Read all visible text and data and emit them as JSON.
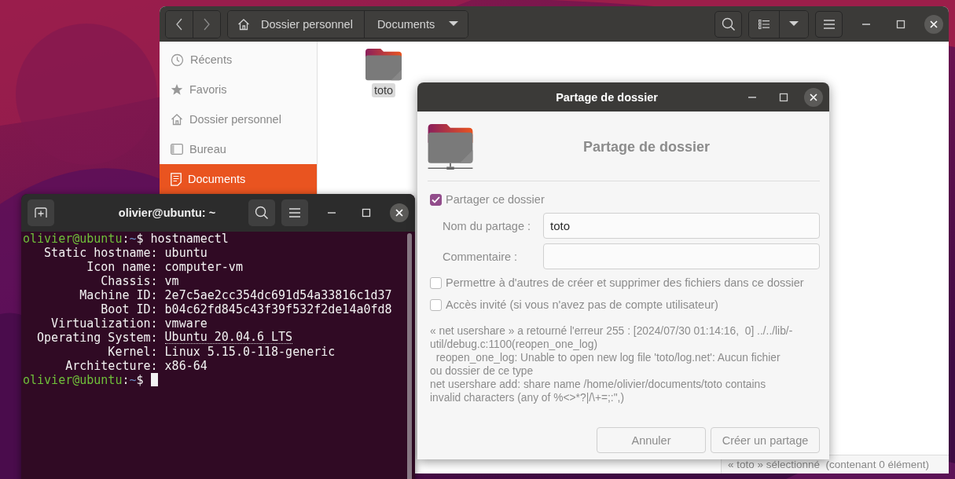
{
  "file_manager": {
    "path": [
      {
        "kind": "home",
        "label": "Dossier personnel"
      },
      {
        "kind": "current",
        "label": "Documents"
      }
    ],
    "sidebar": [
      {
        "kind": "recent",
        "label": "Récents",
        "selected": false
      },
      {
        "kind": "star",
        "label": "Favoris",
        "selected": false
      },
      {
        "kind": "home",
        "label": "Dossier personnel",
        "selected": false
      },
      {
        "kind": "desktop",
        "label": "Bureau",
        "selected": false
      },
      {
        "kind": "document",
        "label": "Documents",
        "selected": true
      }
    ],
    "files": [
      {
        "name": "toto",
        "selected": true
      }
    ],
    "status_bar": "« toto » sélectionné  (contenant 0 élément)"
  },
  "terminal": {
    "title": "olivier@ubuntu: ~",
    "lines": [
      {
        "kind": "prompt",
        "cursor": false,
        "segments": [
          {
            "text": "olivier@ubuntu",
            "color": "#6fbf3a"
          },
          {
            "text": ":"
          },
          {
            "text": "~",
            "color": "#6c90c8"
          },
          {
            "text": "$ hostnamectl"
          }
        ]
      },
      {
        "kind": "field",
        "label": "Static hostname:",
        "value": "ubuntu",
        "underlined": false
      },
      {
        "kind": "field",
        "label": "Icon name:",
        "value": "computer-vm",
        "underlined": false
      },
      {
        "kind": "field",
        "label": "Chassis:",
        "value": "vm",
        "underlined": false
      },
      {
        "kind": "field",
        "label": "Machine ID:",
        "value": "2e7c5ae2cc354dc691d54a33816c1d37",
        "underlined": false
      },
      {
        "kind": "field",
        "label": "Boot ID:",
        "value": "b04c62fd845c43f39f532f2de14a0fd8",
        "underlined": false
      },
      {
        "kind": "field",
        "label": "Virtualization:",
        "value": "vmware",
        "underlined": false
      },
      {
        "kind": "field",
        "label": "Operating System:",
        "value": "Ubuntu 20.04.6 LTS",
        "underlined": true
      },
      {
        "kind": "field",
        "label": "Kernel:",
        "value": "Linux 5.15.0-118-generic",
        "underlined": false
      },
      {
        "kind": "field",
        "label": "Architecture:",
        "value": "x86-64",
        "underlined": false
      },
      {
        "kind": "prompt",
        "cursor": true,
        "segments": [
          {
            "text": "olivier@ubuntu",
            "color": "#6fbf3a"
          },
          {
            "text": ":"
          },
          {
            "text": "~",
            "color": "#6c90c8"
          },
          {
            "text": "$"
          }
        ]
      }
    ]
  },
  "dialog": {
    "title": "Partage de dossier",
    "heading": "Partage de dossier",
    "share_toggle": {
      "label": "Partager ce dossier",
      "checked": true
    },
    "fields": [
      {
        "label": "Nom du partage :",
        "value": "toto"
      },
      {
        "label": "Commentaire :"
      }
    ],
    "options": [
      {
        "label": "Permettre à d'autres de créer et supprimer des fichiers dans ce dossier",
        "checked": false
      },
      {
        "label": "Accès invité (si vous n'avez pas de compte utilisateur)",
        "checked": false
      }
    ],
    "message": "« net usershare » a retourné l'erreur 255 : [2024/07/30 01:14:16,  0] ../../lib/-\nutil/debug.c:1100(reopen_one_log)\n  reopen_one_log: Unable to open new log file 'toto/log.net': Aucun fichier\nou dossier de ce type\nnet usershare add: share name /home/olivier/documents/toto contains\ninvalid characters (any of %<>*?|/\\+=;:\",)",
    "buttons": [
      "Annuler",
      "Créer un partage"
    ]
  }
}
